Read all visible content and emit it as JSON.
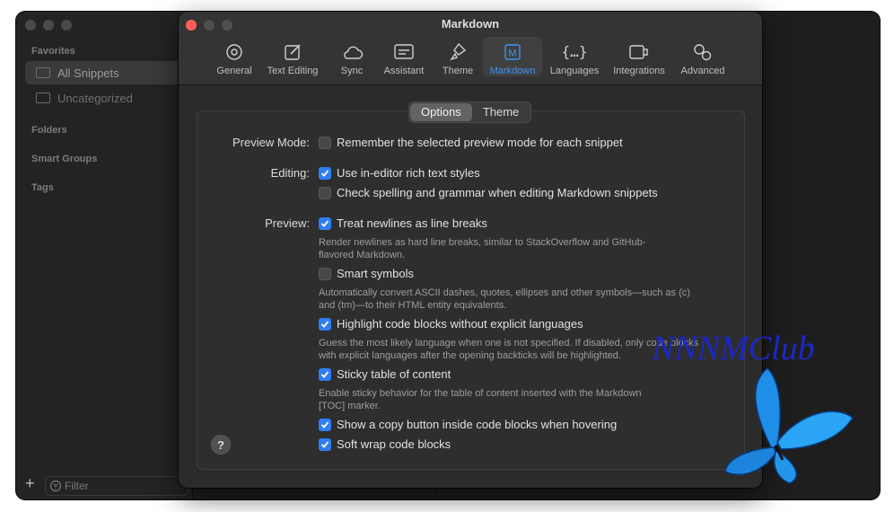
{
  "sidebar": {
    "favorites_header": "Favorites",
    "items": [
      {
        "label": "All Snippets"
      },
      {
        "label": "Uncategorized"
      }
    ],
    "folders_header": "Folders",
    "smart_groups_header": "Smart Groups",
    "tags_header": "Tags",
    "filter_placeholder": "Filter",
    "add_label": "+"
  },
  "window": {
    "title": "Markdown",
    "tabs": [
      {
        "label": "General",
        "icon": "gear-icon"
      },
      {
        "label": "Text Editing",
        "icon": "edit-icon"
      },
      {
        "label": "Sync",
        "icon": "cloud-icon"
      },
      {
        "label": "Assistant",
        "icon": "assistant-icon"
      },
      {
        "label": "Theme",
        "icon": "brush-icon"
      },
      {
        "label": "Markdown",
        "icon": "markdown-icon",
        "selected": true
      },
      {
        "label": "Languages",
        "icon": "braces-icon"
      },
      {
        "label": "Integrations",
        "icon": "plugin-icon"
      },
      {
        "label": "Advanced",
        "icon": "gears-icon"
      }
    ]
  },
  "segmented": {
    "options": "Options",
    "theme": "Theme",
    "selected": "Options"
  },
  "labels": {
    "preview_mode": "Preview Mode:",
    "editing": "Editing:",
    "preview": "Preview:"
  },
  "options": {
    "remember_preview": {
      "label": "Remember the selected preview mode for each snippet",
      "checked": false
    },
    "rich_text": {
      "label": "Use in-editor rich text styles",
      "checked": true
    },
    "spelling": {
      "label": "Check spelling and grammar when editing Markdown snippets",
      "checked": false
    },
    "newlines": {
      "label": "Treat newlines as line breaks",
      "checked": true,
      "desc1": "Render newlines as hard line breaks, similar to StackOverflow and GitHub-",
      "desc2": "flavored Markdown."
    },
    "smart_symbols": {
      "label": "Smart symbols",
      "checked": false,
      "desc1": "Automatically convert ASCII dashes, quotes, ellipses and other symbols—such as (c)",
      "desc2": "and (tm)—to their HTML entity equivalents."
    },
    "highlight": {
      "label": "Highlight code blocks without explicit languages",
      "checked": true,
      "desc1": "Guess the most likely language when one is not specified. If disabled, only code blocks",
      "desc2": "with explicit languages after the opening backticks will be highlighted."
    },
    "sticky_toc": {
      "label": "Sticky table of content",
      "checked": true,
      "desc1": "Enable sticky behavior for the table of content inserted with the Markdown",
      "desc2": "[TOC] marker."
    },
    "copy_button": {
      "label": "Show a copy button inside code blocks when hovering",
      "checked": true
    },
    "soft_wrap": {
      "label": "Soft wrap code blocks",
      "checked": true
    }
  },
  "help_label": "?",
  "watermark": "NNNMClub",
  "colors": {
    "accent": "#2f7df4",
    "close": "#ff5f57"
  }
}
